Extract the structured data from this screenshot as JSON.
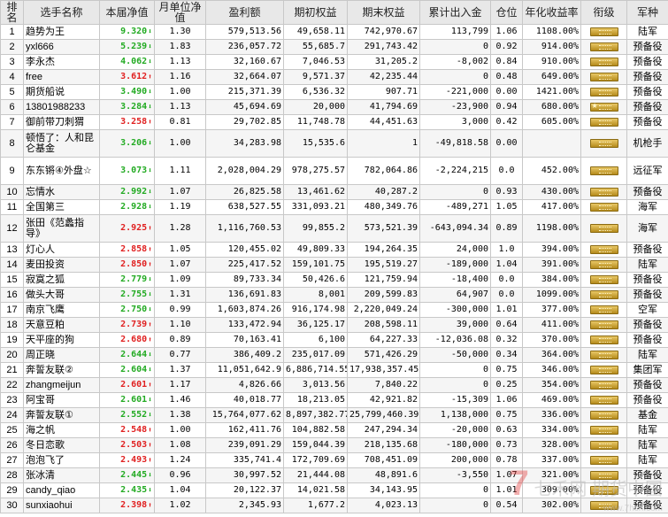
{
  "headers": [
    "排名",
    "选手名称",
    "本届净值",
    "月单位净值",
    "盈利额",
    "期初权益",
    "期末权益",
    "累计出入金",
    "仓位",
    "年化收益率",
    "衔级",
    "军种"
  ],
  "rows": [
    {
      "rank": "1",
      "name": "趋势为王",
      "nav": "9.320",
      "up": true,
      "unit": "1.30",
      "profit": "579,513.56",
      "start": "49,658.11",
      "end": "742,970.67",
      "flow": "113,799",
      "pos": "1.06",
      "annual": "1108.00%",
      "star": false,
      "branch": "陆军"
    },
    {
      "rank": "2",
      "name": "yxl666",
      "nav": "5.239",
      "up": true,
      "unit": "1.83",
      "profit": "236,057.72",
      "start": "55,685.7",
      "end": "291,743.42",
      "flow": "0",
      "pos": "0.92",
      "annual": "914.00%",
      "star": false,
      "branch": "预备役"
    },
    {
      "rank": "3",
      "name": "李永杰",
      "nav": "4.062",
      "up": true,
      "unit": "1.13",
      "profit": "32,160.67",
      "start": "7,046.53",
      "end": "31,205.2",
      "flow": "-8,002",
      "pos": "0.84",
      "annual": "910.00%",
      "star": false,
      "branch": "预备役"
    },
    {
      "rank": "4",
      "name": "free",
      "nav": "3.612",
      "up": false,
      "unit": "1.16",
      "profit": "32,664.07",
      "start": "9,571.37",
      "end": "42,235.44",
      "flow": "0",
      "pos": "0.48",
      "annual": "649.00%",
      "star": false,
      "branch": "预备役"
    },
    {
      "rank": "5",
      "name": "期货船说",
      "nav": "3.490",
      "up": true,
      "unit": "1.00",
      "profit": "215,371.39",
      "start": "6,536.32",
      "end": "907.71",
      "flow": "-221,000",
      "pos": "0.00",
      "annual": "1421.00%",
      "star": false,
      "branch": "预备役"
    },
    {
      "rank": "6",
      "name": "13801988233",
      "nav": "3.284",
      "up": true,
      "unit": "1.13",
      "profit": "45,694.69",
      "start": "20,000",
      "end": "41,794.69",
      "flow": "-23,900",
      "pos": "0.94",
      "annual": "680.00%",
      "star": true,
      "branch": "预备役"
    },
    {
      "rank": "7",
      "name": "御前带刀刺猬",
      "nav": "3.258",
      "up": false,
      "unit": "0.81",
      "profit": "29,702.85",
      "start": "11,748.78",
      "end": "44,451.63",
      "flow": "3,000",
      "pos": "0.42",
      "annual": "605.00%",
      "star": false,
      "branch": "预备役"
    },
    {
      "rank": "8",
      "name": "顿悟了：人和昆仑基金",
      "nav": "3.206",
      "up": true,
      "unit": "1.00",
      "profit": "34,283.98",
      "start": "15,535.6",
      "end": "1",
      "flow": "-49,818.58",
      "pos": "0.00",
      "annual": "",
      "star": false,
      "branch": "机枪手"
    },
    {
      "rank": "9",
      "name": "东东锵④外盘☆",
      "nav": "3.073",
      "up": true,
      "unit": "1.11",
      "profit": "2,028,004.29",
      "start": "978,275.57",
      "end": "782,064.86",
      "flow": "-2,224,215",
      "pos": "0.0",
      "annual": "452.00%",
      "star": false,
      "branch": "远征军"
    },
    {
      "rank": "10",
      "name": "忘情水",
      "nav": "2.992",
      "up": true,
      "unit": "1.07",
      "profit": "26,825.58",
      "start": "13,461.62",
      "end": "40,287.2",
      "flow": "0",
      "pos": "0.93",
      "annual": "430.00%",
      "star": false,
      "branch": "预备役"
    },
    {
      "rank": "11",
      "name": "全国第三",
      "nav": "2.928",
      "up": true,
      "unit": "1.19",
      "profit": "638,527.55",
      "start": "331,093.21",
      "end": "480,349.76",
      "flow": "-489,271",
      "pos": "1.05",
      "annual": "417.00%",
      "star": false,
      "branch": "海军"
    },
    {
      "rank": "12",
      "name": "张田《范蠡指导》",
      "nav": "2.925",
      "up": false,
      "unit": "1.28",
      "profit": "1,116,760.53",
      "start": "99,855.2",
      "end": "573,521.39",
      "flow": "-643,094.34",
      "pos": "0.89",
      "annual": "1198.00%",
      "star": false,
      "branch": "海军"
    },
    {
      "rank": "13",
      "name": "灯心人",
      "nav": "2.858",
      "up": false,
      "unit": "1.05",
      "profit": "120,455.02",
      "start": "49,809.33",
      "end": "194,264.35",
      "flow": "24,000",
      "pos": "1.0",
      "annual": "394.00%",
      "star": false,
      "branch": "预备役"
    },
    {
      "rank": "14",
      "name": "麦田投资",
      "nav": "2.850",
      "up": false,
      "unit": "1.07",
      "profit": "225,417.52",
      "start": "159,101.75",
      "end": "195,519.27",
      "flow": "-189,000",
      "pos": "1.04",
      "annual": "391.00%",
      "star": false,
      "branch": "陆军"
    },
    {
      "rank": "15",
      "name": "寂寞之狐",
      "nav": "2.779",
      "up": true,
      "unit": "1.09",
      "profit": "89,733.34",
      "start": "50,426.6",
      "end": "121,759.94",
      "flow": "-18,400",
      "pos": "0.0",
      "annual": "384.00%",
      "star": false,
      "branch": "预备役"
    },
    {
      "rank": "16",
      "name": "做头大哥",
      "nav": "2.755",
      "up": true,
      "unit": "1.31",
      "profit": "136,691.83",
      "start": "8,001",
      "end": "209,599.83",
      "flow": "64,907",
      "pos": "0.0",
      "annual": "1099.00%",
      "star": false,
      "branch": "预备役"
    },
    {
      "rank": "17",
      "name": "南京飞鹰",
      "nav": "2.750",
      "up": true,
      "unit": "0.99",
      "profit": "1,603,874.26",
      "start": "916,174.98",
      "end": "2,220,049.24",
      "flow": "-300,000",
      "pos": "1.01",
      "annual": "377.00%",
      "star": false,
      "branch": "空军"
    },
    {
      "rank": "18",
      "name": "天意豆粕",
      "nav": "2.739",
      "up": false,
      "unit": "1.10",
      "profit": "133,472.94",
      "start": "36,125.17",
      "end": "208,598.11",
      "flow": "39,000",
      "pos": "0.64",
      "annual": "411.00%",
      "star": false,
      "branch": "预备役"
    },
    {
      "rank": "19",
      "name": "天平座的狗",
      "nav": "2.680",
      "up": false,
      "unit": "0.89",
      "profit": "70,163.41",
      "start": "6,100",
      "end": "64,227.33",
      "flow": "-12,036.08",
      "pos": "0.32",
      "annual": "370.00%",
      "star": false,
      "branch": "预备役"
    },
    {
      "rank": "20",
      "name": "周正晓",
      "nav": "2.644",
      "up": true,
      "unit": "0.77",
      "profit": "386,409.2",
      "start": "235,017.09",
      "end": "571,426.29",
      "flow": "-50,000",
      "pos": "0.34",
      "annual": "364.00%",
      "star": false,
      "branch": "陆军"
    },
    {
      "rank": "21",
      "name": "奔誓友联②",
      "nav": "2.604",
      "up": true,
      "unit": "1.37",
      "profit": "11,051,642.9",
      "start": "6,886,714.55",
      "end": "17,938,357.45",
      "flow": "0",
      "pos": "0.75",
      "annual": "346.00%",
      "star": false,
      "branch": "集团军"
    },
    {
      "rank": "22",
      "name": "zhangmeijun",
      "nav": "2.601",
      "up": false,
      "unit": "1.17",
      "profit": "4,826.66",
      "start": "3,013.56",
      "end": "7,840.22",
      "flow": "0",
      "pos": "0.25",
      "annual": "354.00%",
      "star": false,
      "branch": "预备役"
    },
    {
      "rank": "23",
      "name": "阿宝哥",
      "nav": "2.601",
      "up": true,
      "unit": "1.46",
      "profit": "40,018.77",
      "start": "18,213.05",
      "end": "42,921.82",
      "flow": "-15,309",
      "pos": "1.06",
      "annual": "469.00%",
      "star": false,
      "branch": "预备役"
    },
    {
      "rank": "24",
      "name": "奔誓友联①",
      "nav": "2.552",
      "up": true,
      "unit": "1.38",
      "profit": "15,764,077.62",
      "start": "8,897,382.77",
      "end": "25,799,460.39",
      "flow": "1,138,000",
      "pos": "0.75",
      "annual": "336.00%",
      "star": false,
      "branch": "基金"
    },
    {
      "rank": "25",
      "name": "海之帆",
      "nav": "2.548",
      "up": false,
      "unit": "1.00",
      "profit": "162,411.76",
      "start": "104,882.58",
      "end": "247,294.34",
      "flow": "-20,000",
      "pos": "0.63",
      "annual": "334.00%",
      "star": false,
      "branch": "陆军"
    },
    {
      "rank": "26",
      "name": "冬日恋歌",
      "nav": "2.503",
      "up": false,
      "unit": "1.08",
      "profit": "239,091.29",
      "start": "159,044.39",
      "end": "218,135.68",
      "flow": "-180,000",
      "pos": "0.73",
      "annual": "328.00%",
      "star": false,
      "branch": "陆军"
    },
    {
      "rank": "27",
      "name": "泡泡飞了",
      "nav": "2.493",
      "up": false,
      "unit": "1.24",
      "profit": "335,741.4",
      "start": "172,709.69",
      "end": "708,451.09",
      "flow": "200,000",
      "pos": "0.78",
      "annual": "337.00%",
      "star": false,
      "branch": "陆军"
    },
    {
      "rank": "28",
      "name": "张冰清",
      "nav": "2.445",
      "up": true,
      "unit": "0.96",
      "profit": "30,997.52",
      "start": "21,444.08",
      "end": "48,891.6",
      "flow": "-3,550",
      "pos": "1.07",
      "annual": "321.00%",
      "star": false,
      "branch": "预备役"
    },
    {
      "rank": "29",
      "name": "candy_qiao",
      "nav": "2.435",
      "up": true,
      "unit": "1.04",
      "profit": "20,122.37",
      "start": "14,021.58",
      "end": "34,143.95",
      "flow": "0",
      "pos": "1.01",
      "annual": "309.00%",
      "star": false,
      "branch": "预备役"
    },
    {
      "rank": "30",
      "name": "sunxiaohui",
      "nav": "2.398",
      "up": false,
      "unit": "1.02",
      "profit": "2,345.93",
      "start": "1,677.2",
      "end": "4,023.13",
      "flow": "0",
      "pos": "0.54",
      "annual": "302.00%",
      "star": false,
      "branch": "预备役"
    }
  ],
  "watermark": {
    "logo": "7",
    "text": "七禾网 期货中国",
    "url": "www.7hcn.com"
  },
  "colors": {
    "up": "#22aa22",
    "down": "#e02020",
    "header_bg": "#e8e8e8",
    "border": "#c8c8c8"
  }
}
